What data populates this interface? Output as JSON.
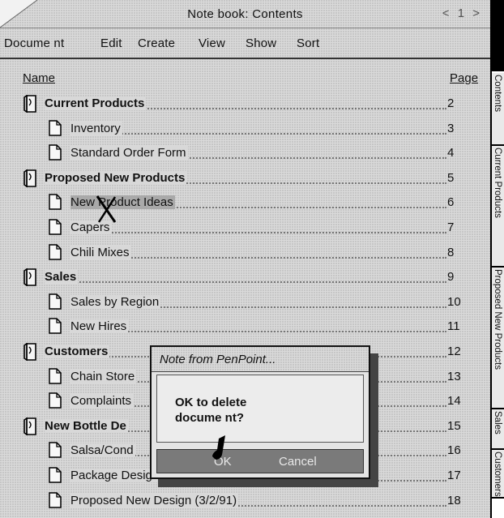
{
  "window": {
    "title": "Note book: Contents",
    "page_indicator": "< 1 >"
  },
  "menu": [
    {
      "label": "Docume nt"
    },
    {
      "label": "Edit"
    },
    {
      "label": "Create"
    },
    {
      "label": "View"
    },
    {
      "label": "Show"
    },
    {
      "label": "Sort"
    }
  ],
  "columns": {
    "name": "Name",
    "page": "Page"
  },
  "rows": [
    {
      "label": "Current Products",
      "page": "2",
      "type": "section",
      "icon": "notebook-section-icon"
    },
    {
      "label": "Inventory",
      "page": "3",
      "type": "doc",
      "icon": "document-icon"
    },
    {
      "label": "Standard Order Form",
      "page": "4",
      "type": "doc",
      "icon": "document-icon"
    },
    {
      "label": "Proposed New Products",
      "page": "5",
      "type": "section",
      "icon": "notebook-section-icon"
    },
    {
      "label": "New Product Ideas",
      "page": "6",
      "type": "doc",
      "icon": "document-icon",
      "selected": true
    },
    {
      "label": "Capers",
      "page": "7",
      "type": "doc",
      "icon": "document-icon"
    },
    {
      "label": "Chili Mixes",
      "page": "8",
      "type": "doc",
      "icon": "document-icon"
    },
    {
      "label": "Sales",
      "page": "9",
      "type": "section",
      "icon": "notebook-section-icon"
    },
    {
      "label": "Sales by Region",
      "page": "10",
      "type": "doc",
      "icon": "document-icon"
    },
    {
      "label": "New Hires",
      "page": "11",
      "type": "doc",
      "icon": "document-icon"
    },
    {
      "label": "Customers",
      "page": "12",
      "type": "section",
      "icon": "notebook-section-icon"
    },
    {
      "label": "Chain Store",
      "page": "13",
      "type": "doc",
      "icon": "document-icon"
    },
    {
      "label": "Complaints",
      "page": "14",
      "type": "doc",
      "icon": "document-icon"
    },
    {
      "label": "New Bottle De",
      "page": "15",
      "type": "section",
      "icon": "notebook-section-icon"
    },
    {
      "label": "Salsa/Cond",
      "page": "16",
      "type": "doc",
      "icon": "document-icon"
    },
    {
      "label": "Package Design Letter",
      "page": "17",
      "type": "doc",
      "icon": "document-icon"
    },
    {
      "label": "Proposed New Design (3/2/91)",
      "page": "18",
      "type": "doc",
      "icon": "document-icon"
    }
  ],
  "tabs": [
    {
      "label": "Contents"
    },
    {
      "label": "Current Products"
    },
    {
      "label": "Proposed New Products"
    },
    {
      "label": "Sales"
    },
    {
      "label": "Customers"
    }
  ],
  "dialog": {
    "title": "Note from PenPoint...",
    "message": "OK to delete docume nt?",
    "ok_label": "OK",
    "cancel_label": "Cancel"
  }
}
